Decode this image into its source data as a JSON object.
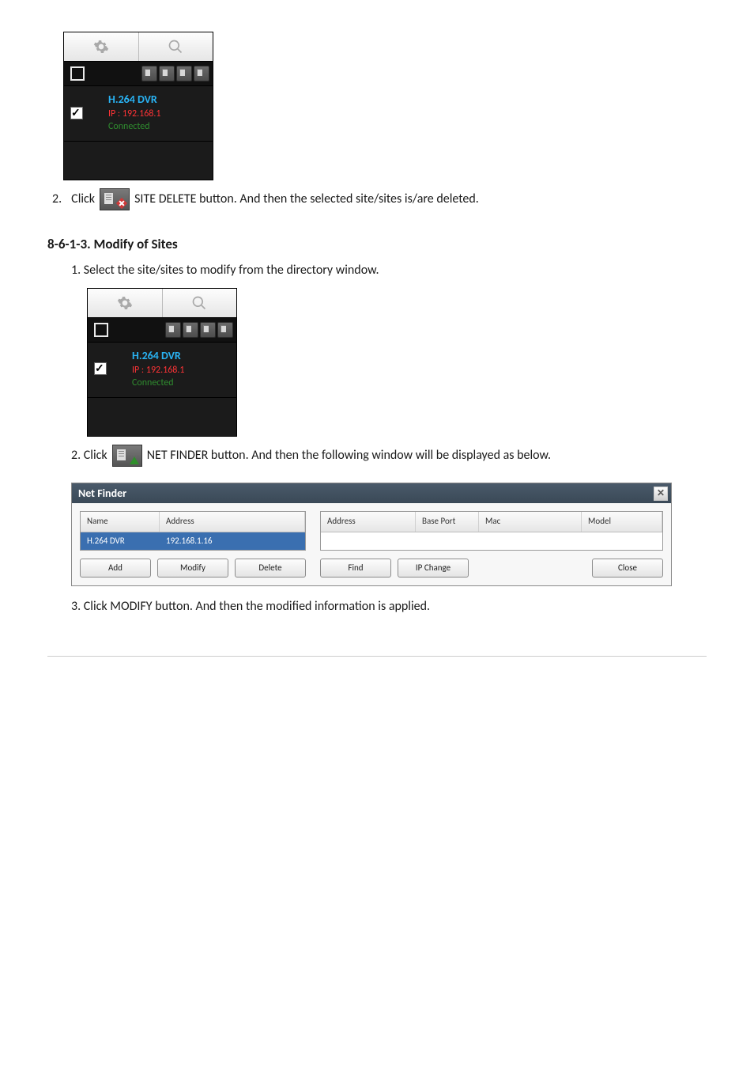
{
  "panel": {
    "dvr_label": "H.264 DVR",
    "ip_label": "IP : 192.168.1",
    "status_label": "Connected"
  },
  "site_delete": {
    "prefix_num": "2.",
    "prefix_word": "Click",
    "tail": "SITE DELETE button. And then the selected site/sites is/are deleted."
  },
  "modify_heading": "8-6-1-3. Modify of Sites",
  "modify_step1": "1. Select the site/sites to modify from the directory window.",
  "net_finder_line": {
    "prefix": "2. Click",
    "tail": "NET FINDER button. And then the following window will be displayed as below."
  },
  "netfinder": {
    "title": "Net Finder",
    "left": {
      "headers": {
        "name": "Name",
        "address": "Address"
      },
      "row": {
        "name": "H.264 DVR",
        "address": "192.168.1.16"
      },
      "buttons": {
        "add": "Add",
        "modify": "Modify",
        "delete": "Delete"
      }
    },
    "right": {
      "headers": {
        "address": "Address",
        "base_port": "Base Port",
        "mac": "Mac",
        "model": "Model"
      },
      "buttons": {
        "find": "Find",
        "ip_change": "IP Change",
        "close": "Close"
      }
    }
  },
  "modify_step3": "3. Click MODIFY button. And then the modified information is applied."
}
